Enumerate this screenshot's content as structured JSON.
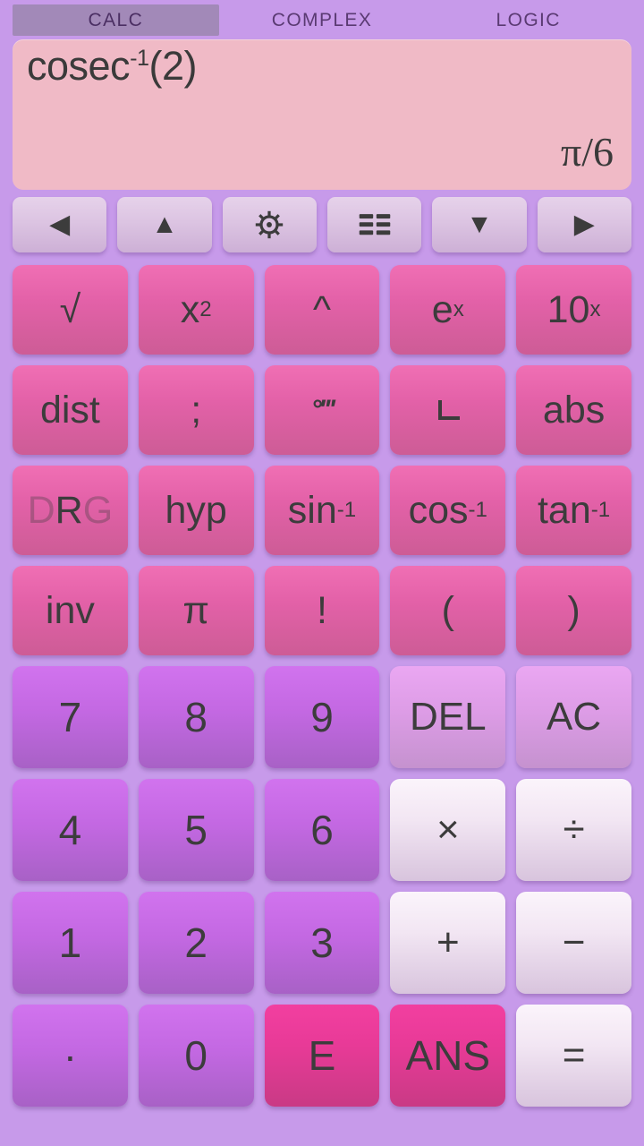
{
  "app": {
    "background_color": "#c79aea"
  },
  "tabs": [
    {
      "label": "CALC",
      "active": true
    },
    {
      "label": "COMPLEX",
      "active": false
    },
    {
      "label": "LOGIC",
      "active": false
    }
  ],
  "display": {
    "background_color": "#f0bac6",
    "expression_text": "cosec",
    "expression_sup": "-1",
    "expression_tail": "(2)",
    "result": "π/6"
  },
  "nav_row": [
    {
      "name": "cursor-left",
      "glyph": "◀"
    },
    {
      "name": "cursor-up",
      "glyph": "▲"
    },
    {
      "name": "settings",
      "glyph": "gear-icon"
    },
    {
      "name": "history-list",
      "glyph": "list-icon"
    },
    {
      "name": "cursor-down",
      "glyph": "▼"
    },
    {
      "name": "cursor-right",
      "glyph": "▶"
    }
  ],
  "keys": {
    "row1": [
      {
        "label": "√",
        "name": "sqrt"
      },
      {
        "label": "x",
        "sup": "2",
        "name": "square"
      },
      {
        "label": "^",
        "name": "power"
      },
      {
        "label": "e",
        "sup": "x",
        "name": "exp"
      },
      {
        "label": "10",
        "sup": "x",
        "name": "ten-power"
      }
    ],
    "row2": [
      {
        "label": "dist",
        "name": "dist"
      },
      {
        "label": ";",
        "name": "semicolon"
      },
      {
        "label": "°‴",
        "name": "degree-minute-second"
      },
      {
        "label": "⌐",
        "name": "angle"
      },
      {
        "label": "abs",
        "name": "abs"
      }
    ],
    "row3": [
      {
        "label": "DRG",
        "name": "drg-mode",
        "mode_d": "D",
        "mode_r": "R",
        "mode_g": "G",
        "active_mode": "R"
      },
      {
        "label": "hyp",
        "name": "hyp"
      },
      {
        "label": "sin",
        "sup": "-1",
        "name": "arcsin"
      },
      {
        "label": "cos",
        "sup": "-1",
        "name": "arccos"
      },
      {
        "label": "tan",
        "sup": "-1",
        "name": "arctan"
      }
    ],
    "row4": [
      {
        "label": "inv",
        "name": "inv"
      },
      {
        "label": "π",
        "name": "pi"
      },
      {
        "label": "!",
        "name": "factorial"
      },
      {
        "label": "(",
        "name": "paren-open"
      },
      {
        "label": ")",
        "name": "paren-close"
      }
    ],
    "row5": [
      {
        "label": "7",
        "name": "digit-7",
        "style": "num"
      },
      {
        "label": "8",
        "name": "digit-8",
        "style": "num"
      },
      {
        "label": "9",
        "name": "digit-9",
        "style": "num"
      },
      {
        "label": "DEL",
        "name": "delete",
        "style": "edit"
      },
      {
        "label": "AC",
        "name": "all-clear",
        "style": "edit"
      }
    ],
    "row6": [
      {
        "label": "4",
        "name": "digit-4",
        "style": "num"
      },
      {
        "label": "5",
        "name": "digit-5",
        "style": "num"
      },
      {
        "label": "6",
        "name": "digit-6",
        "style": "num"
      },
      {
        "label": "×",
        "name": "multiply",
        "style": "op"
      },
      {
        "label": "÷",
        "name": "divide",
        "style": "op"
      }
    ],
    "row7": [
      {
        "label": "1",
        "name": "digit-1",
        "style": "num"
      },
      {
        "label": "2",
        "name": "digit-2",
        "style": "num"
      },
      {
        "label": "3",
        "name": "digit-3",
        "style": "num"
      },
      {
        "label": "+",
        "name": "plus",
        "style": "op"
      },
      {
        "label": "−",
        "name": "minus",
        "style": "op"
      }
    ],
    "row8": [
      {
        "label": "·",
        "name": "decimal-point",
        "style": "num"
      },
      {
        "label": "0",
        "name": "digit-0",
        "style": "num"
      },
      {
        "label": "E",
        "name": "exponent",
        "style": "hot"
      },
      {
        "label": "ANS",
        "name": "answer",
        "style": "hot"
      },
      {
        "label": "=",
        "name": "equals",
        "style": "op"
      }
    ]
  }
}
